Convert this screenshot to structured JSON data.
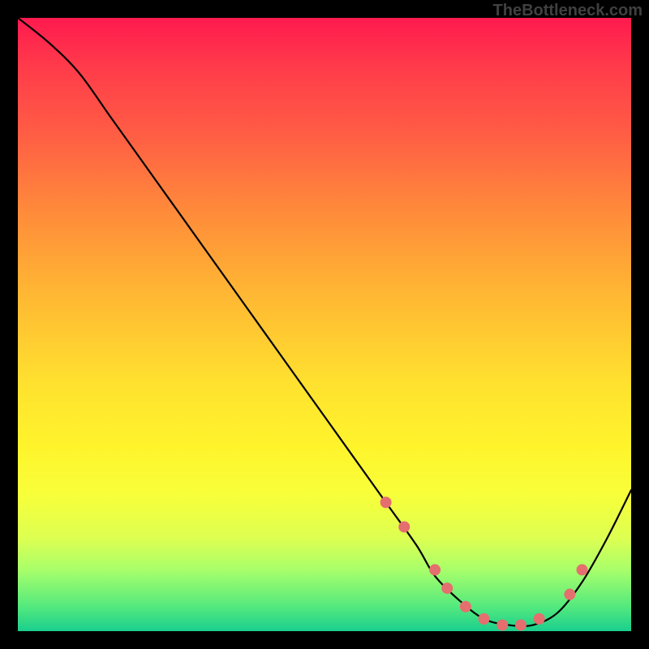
{
  "watermark": "TheBottleneck.com",
  "chart_data": {
    "type": "line",
    "title": "",
    "xlabel": "",
    "ylabel": "",
    "xlim": [
      0,
      100
    ],
    "ylim": [
      0,
      100
    ],
    "series": [
      {
        "name": "bottleneck-curve",
        "x": [
          0,
          5,
          10,
          15,
          20,
          25,
          30,
          35,
          40,
          45,
          50,
          55,
          60,
          65,
          68,
          72,
          76,
          80,
          84,
          88,
          92,
          96,
          100
        ],
        "y": [
          100,
          96,
          91,
          84,
          77,
          70,
          63,
          56,
          49,
          42,
          35,
          28,
          21,
          14,
          9,
          5,
          2,
          1,
          1,
          3,
          8,
          15,
          23
        ]
      }
    ],
    "markers": {
      "name": "highlight-dots",
      "color": "#e46f6e",
      "x": [
        60,
        63,
        68,
        70,
        73,
        76,
        79,
        82,
        85,
        90,
        92
      ],
      "y": [
        21,
        17,
        10,
        7,
        4,
        2,
        1,
        1,
        2,
        6,
        10
      ]
    },
    "gradient_stops": [
      {
        "pos": 0.0,
        "color": "#ff1a4f"
      },
      {
        "pos": 0.32,
        "color": "#ff8c3a"
      },
      {
        "pos": 0.6,
        "color": "#ffe22f"
      },
      {
        "pos": 0.85,
        "color": "#dcff52"
      },
      {
        "pos": 1.0,
        "color": "#19cf8d"
      }
    ]
  }
}
